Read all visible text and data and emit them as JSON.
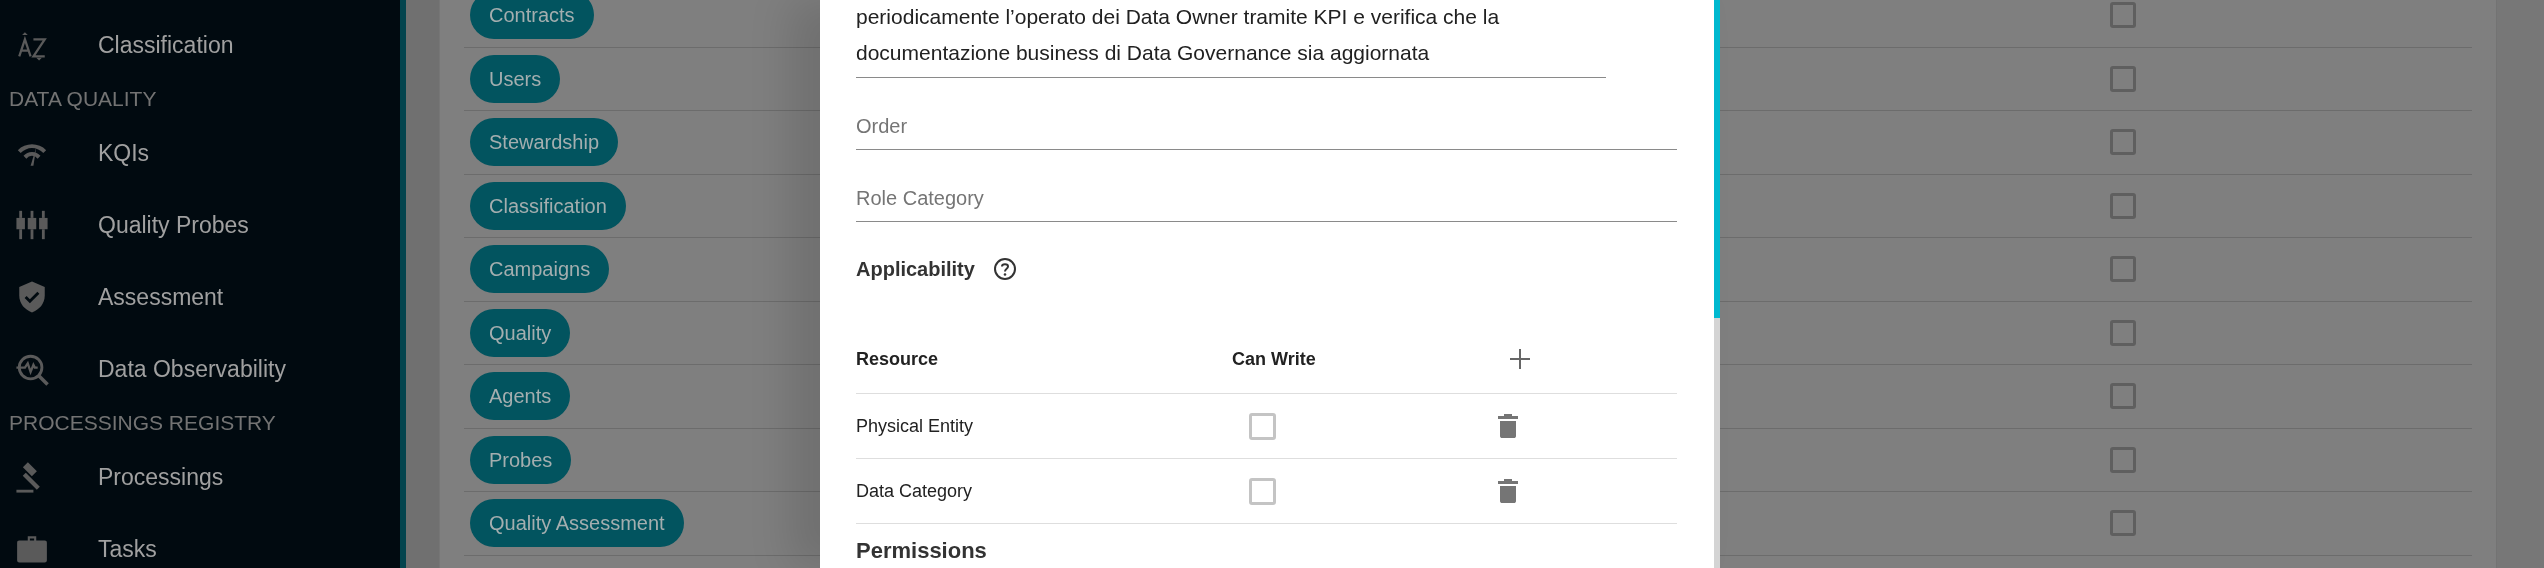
{
  "sidebar": {
    "items": [
      {
        "kind": "item",
        "label": "Classification"
      },
      {
        "kind": "section",
        "label": "DATA QUALITY"
      },
      {
        "kind": "item",
        "label": "KQIs"
      },
      {
        "kind": "item",
        "label": "Quality Probes"
      },
      {
        "kind": "item",
        "label": "Assessment"
      },
      {
        "kind": "item",
        "label": "Data Observability"
      },
      {
        "kind": "section",
        "label": "PROCESSINGS REGISTRY"
      },
      {
        "kind": "item",
        "label": "Processings"
      },
      {
        "kind": "item",
        "label": "Tasks"
      }
    ]
  },
  "table": {
    "rows": [
      {
        "label": "Contracts",
        "checked": false
      },
      {
        "label": "Users",
        "checked": false
      },
      {
        "label": "Stewardship",
        "checked": false
      },
      {
        "label": "Classification",
        "checked": false
      },
      {
        "label": "Campaigns",
        "checked": false
      },
      {
        "label": "Quality",
        "checked": false
      },
      {
        "label": "Agents",
        "checked": false
      },
      {
        "label": "Probes",
        "checked": false
      },
      {
        "label": "Quality Assessment",
        "checked": false
      }
    ]
  },
  "dialog": {
    "description": {
      "value": "periodicamente l’operato dei Data Owner tramite KPI e verifica che la documentazione business di Data Governance sia aggiornata"
    },
    "fields": [
      {
        "placeholder": "Order"
      },
      {
        "placeholder": "Role Category"
      }
    ],
    "applicability": {
      "title": "Applicability",
      "columns": [
        "Resource",
        "Can Write"
      ],
      "rows": [
        {
          "resource": "Physical Entity",
          "can_write": false
        },
        {
          "resource": "Data Category",
          "can_write": false
        }
      ]
    },
    "permissions": {
      "title": "Permissions"
    }
  }
}
